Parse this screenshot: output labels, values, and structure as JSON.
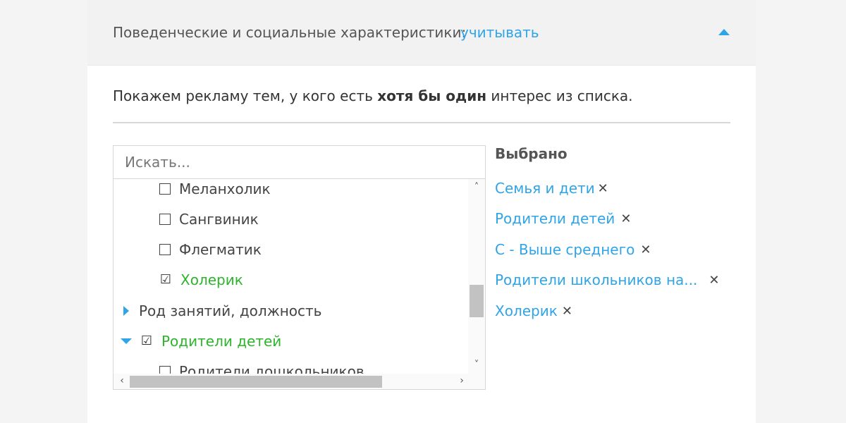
{
  "header": {
    "label": "Поведенческие и социальные характеристики:",
    "value": "учитывать",
    "collapse_icon": "triangle-up-icon"
  },
  "hint": {
    "before": "Покажем рекламу тем, у кого есть ",
    "bold": "хотя бы один",
    "after": " интерес из списка."
  },
  "search": {
    "placeholder": "Искать...",
    "value": ""
  },
  "tree": {
    "items": [
      {
        "label": "Меланхолик",
        "checked": false
      },
      {
        "label": "Сангвиник",
        "checked": false
      },
      {
        "label": "Флегматик",
        "checked": false
      },
      {
        "label": "Холерик",
        "checked": true
      },
      {
        "label": "Род занятий, должность",
        "expanded": false
      },
      {
        "label": "Родители детей",
        "checked": true,
        "expanded": true
      },
      {
        "label": "Родители дошкольников",
        "checked": false
      }
    ],
    "check_mark": "☑",
    "scroll_up": "˄",
    "scroll_down": "˅",
    "scroll_left": "‹",
    "scroll_right": "›"
  },
  "selected": {
    "title": "Выбрано",
    "remove_symbol": "✕",
    "items": [
      "Семья и дети",
      "Родители детей",
      "С - Выше среднего",
      "Родители школьников на...",
      "Холерик"
    ]
  },
  "colors": {
    "accent": "#2fa4e7",
    "checked": "#2db42d"
  }
}
